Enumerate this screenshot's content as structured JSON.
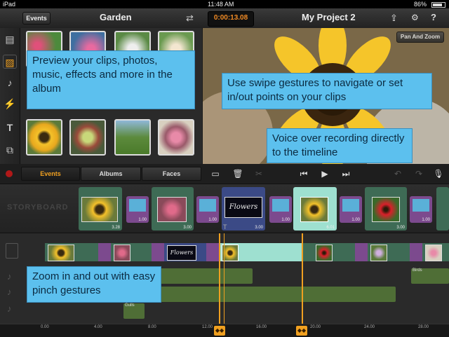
{
  "status_bar": {
    "device": "iPad",
    "time": "11:48 AM",
    "battery": "86%"
  },
  "title_bar": {
    "events_button": "Events",
    "album_title": "Garden",
    "timecode": "0:00:13.08",
    "project_title": "My Project 2"
  },
  "preview": {
    "pan_zoom_label": "Pan And Zoom"
  },
  "browser_tabs": {
    "events": "Events",
    "albums": "Albums",
    "faces": "Faces"
  },
  "storyboard": {
    "label": "STORYBOARD",
    "clips": [
      {
        "duration": "3.28"
      },
      {
        "duration": "3.00"
      },
      {
        "duration": "3.00",
        "title_text": "Flowers"
      },
      {
        "duration": "6.01"
      },
      {
        "duration": "3.00"
      }
    ],
    "transitions": [
      {
        "duration": "1.00"
      },
      {
        "duration": "1.00"
      },
      {
        "duration": "1.00"
      },
      {
        "duration": "1.00"
      },
      {
        "duration": "1.00"
      }
    ]
  },
  "timeline": {
    "title_clip_text": "Flowers",
    "audio_labels": {
      "birds": "Birds",
      "gulls": "Gulls"
    }
  },
  "ruler": {
    "ticks": [
      "0.00",
      "4.00",
      "8.00",
      "12.00",
      "16.00",
      "20.00",
      "24.00",
      "28.00"
    ]
  },
  "callouts": {
    "preview_clips": "Preview your clips, photos, music, effects and more in the album",
    "swipe": "Use swipe gestures to navigate or set in/out points on your clips",
    "voice_over": "Voice over recording directly to the timeline",
    "zoom": "Zoom in and out with easy pinch gestures"
  },
  "colors": {
    "timecode": "#f08a24",
    "callout": "#5cc0ee",
    "clip_green": "#3e6b55",
    "transition_purple": "#7c4a8e",
    "audio_green": "#4f6e36",
    "playhead": "#f0a020"
  },
  "icons": [
    "photo-browser-icon",
    "music-icon",
    "effects-icon",
    "text-icon",
    "share-icon",
    "settings-icon",
    "help-icon",
    "record-icon",
    "trash-icon",
    "skip-back-icon",
    "play-icon",
    "skip-forward-icon",
    "undo-icon",
    "microphone-icon"
  ]
}
